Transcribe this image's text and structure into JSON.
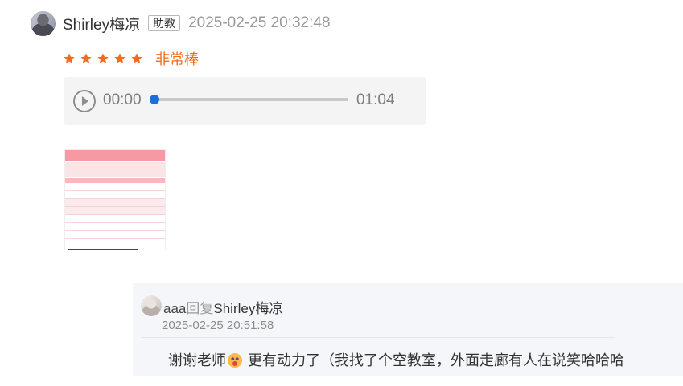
{
  "review": {
    "author": "Shirley梅凉",
    "role_badge": "助教",
    "timestamp": "2025-02-25 20:32:48",
    "rating": {
      "stars": 5,
      "max": 5,
      "label": "非常棒",
      "color": "#f26b1f"
    }
  },
  "audio": {
    "current_time": "00:00",
    "duration": "01:04",
    "progress_fraction": 0,
    "accent": "#1e6fd9"
  },
  "attachment": {
    "icon": "image-thumbnail"
  },
  "reply": {
    "from": "aaa",
    "verb": "回复",
    "to": "Shirley梅凉",
    "timestamp": "2025-02-25 20:51:58",
    "content_before_emoji": "谢谢老师",
    "emoji": "crying-face-emoji",
    "content_after_emoji": " 更有动力了（我找了个空教室，外面走廊有人在说笑哈哈哈"
  }
}
